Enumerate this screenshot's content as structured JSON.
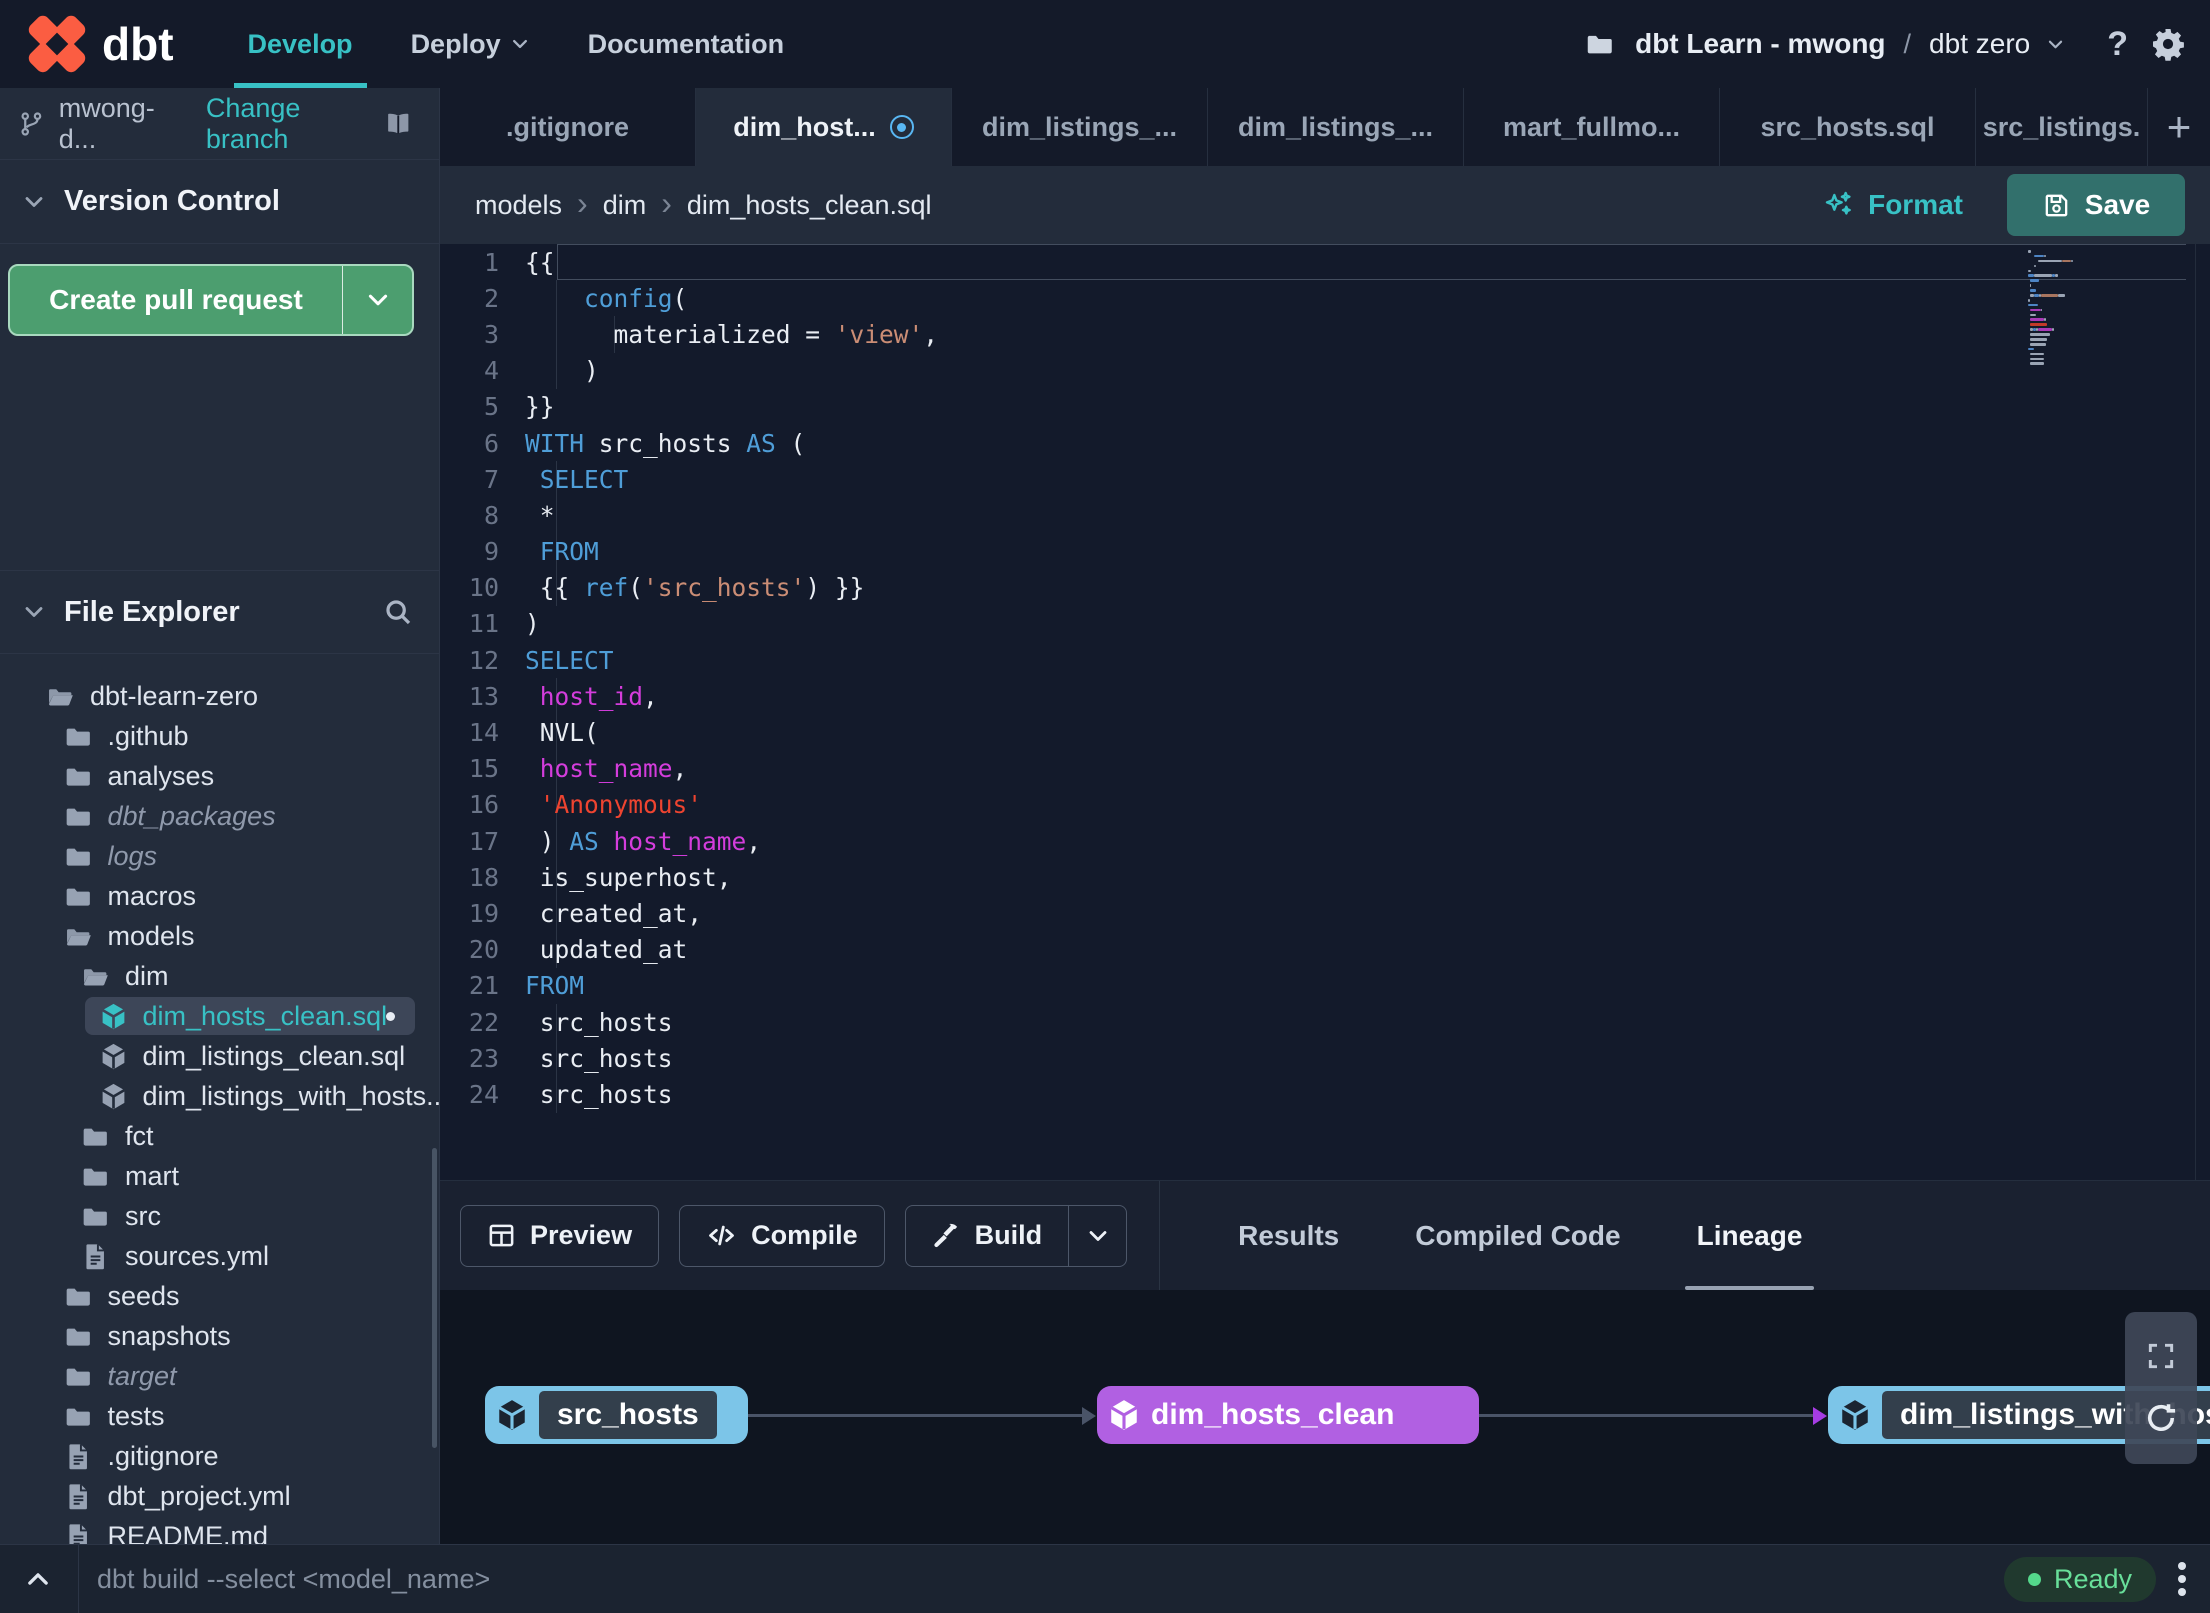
{
  "nav": {
    "brand": "dbt",
    "items": [
      {
        "label": "Develop",
        "active": true
      },
      {
        "label": "Deploy",
        "chevron": true
      },
      {
        "label": "Documentation"
      }
    ],
    "project": {
      "name": "dbt Learn - mwong",
      "separator": "/",
      "env": "dbt zero"
    }
  },
  "sidebar": {
    "branch": {
      "name": "mwong-d...",
      "change_label": "Change branch"
    },
    "version_control": {
      "title": "Version Control",
      "create_pr_label": "Create pull request"
    },
    "file_explorer": {
      "title": "File Explorer",
      "tree": [
        {
          "label": "dbt-learn-zero",
          "type": "folder-open",
          "level": 0
        },
        {
          "label": ".github",
          "type": "folder",
          "level": 1
        },
        {
          "label": "analyses",
          "type": "folder",
          "level": 1
        },
        {
          "label": "dbt_packages",
          "type": "folder",
          "level": 1,
          "italic": true
        },
        {
          "label": "logs",
          "type": "folder",
          "level": 1,
          "italic": true
        },
        {
          "label": "macros",
          "type": "folder",
          "level": 1
        },
        {
          "label": "models",
          "type": "folder-open",
          "level": 1
        },
        {
          "label": "dim",
          "type": "folder-open",
          "level": 2
        },
        {
          "label": "dim_hosts_clean.sql",
          "type": "model",
          "level": 3,
          "selected": true,
          "unsaved": true
        },
        {
          "label": "dim_listings_clean.sql",
          "type": "model",
          "level": 3
        },
        {
          "label": "dim_listings_with_hosts...",
          "type": "model",
          "level": 3
        },
        {
          "label": "fct",
          "type": "folder",
          "level": 2
        },
        {
          "label": "mart",
          "type": "folder",
          "level": 2
        },
        {
          "label": "src",
          "type": "folder",
          "level": 2
        },
        {
          "label": "sources.yml",
          "type": "file",
          "level": 2
        },
        {
          "label": "seeds",
          "type": "folder",
          "level": 1
        },
        {
          "label": "snapshots",
          "type": "folder",
          "level": 1
        },
        {
          "label": "target",
          "type": "folder",
          "level": 1,
          "italic": true
        },
        {
          "label": "tests",
          "type": "folder",
          "level": 1
        },
        {
          "label": ".gitignore",
          "type": "file",
          "level": 1
        },
        {
          "label": "dbt_project.yml",
          "type": "file",
          "level": 1
        },
        {
          "label": "README.md",
          "type": "file",
          "level": 1
        }
      ]
    }
  },
  "tabs": {
    "items": [
      {
        "label": ".gitignore"
      },
      {
        "label": "dim_host...",
        "active": true,
        "dirty": true
      },
      {
        "label": "dim_listings_..."
      },
      {
        "label": "dim_listings_..."
      },
      {
        "label": "mart_fullmo..."
      },
      {
        "label": "src_hosts.sql"
      },
      {
        "label": "src_listings."
      }
    ],
    "add_label": "+"
  },
  "editor": {
    "breadcrumb": [
      "models",
      "dim",
      "dim_hosts_clean.sql"
    ],
    "format_label": "Format",
    "save_label": "Save",
    "lines": [
      {
        "n": 1,
        "active": true,
        "t": [
          [
            "{{",
            "p"
          ]
        ]
      },
      {
        "n": 2,
        "g": [
          0
        ],
        "t": [
          [
            "    ",
            "p"
          ],
          [
            "config",
            "k"
          ],
          [
            "(",
            "p"
          ]
        ]
      },
      {
        "n": 3,
        "g": [
          0,
          4
        ],
        "t": [
          [
            "      materialized = ",
            "p"
          ],
          [
            "'view'",
            "s"
          ],
          [
            ",",
            "p"
          ]
        ]
      },
      {
        "n": 4,
        "g": [
          0
        ],
        "t": [
          [
            "    )",
            "p"
          ]
        ]
      },
      {
        "n": 5,
        "t": [
          [
            "}}",
            "p"
          ]
        ]
      },
      {
        "n": 6,
        "t": [
          [
            "WITH",
            "k"
          ],
          [
            " src_hosts ",
            "p"
          ],
          [
            "AS",
            "k"
          ],
          [
            " (",
            "p"
          ]
        ]
      },
      {
        "n": 7,
        "g": [
          0
        ],
        "t": [
          [
            " ",
            "p"
          ],
          [
            "SELECT",
            "k"
          ]
        ]
      },
      {
        "n": 8,
        "g": [
          0
        ],
        "t": [
          [
            " *",
            "p"
          ]
        ]
      },
      {
        "n": 9,
        "g": [
          0
        ],
        "t": [
          [
            " ",
            "p"
          ],
          [
            "FROM",
            "k"
          ]
        ]
      },
      {
        "n": 10,
        "g": [
          0
        ],
        "t": [
          [
            " {{ ",
            "p"
          ],
          [
            "ref",
            "k"
          ],
          [
            "(",
            "p"
          ],
          [
            "'src_hosts'",
            "s"
          ],
          [
            ") }}",
            "p"
          ]
        ]
      },
      {
        "n": 11,
        "t": [
          [
            ")",
            "p"
          ]
        ]
      },
      {
        "n": 12,
        "t": [
          [
            "SELECT",
            "k"
          ]
        ]
      },
      {
        "n": 13,
        "g": [
          0
        ],
        "t": [
          [
            " ",
            "p"
          ],
          [
            "host_id",
            "f"
          ],
          [
            ",",
            "p"
          ]
        ]
      },
      {
        "n": 14,
        "g": [
          0
        ],
        "t": [
          [
            " NVL(",
            "p"
          ]
        ]
      },
      {
        "n": 15,
        "g": [
          0
        ],
        "t": [
          [
            " ",
            "p"
          ],
          [
            "host_name",
            "f"
          ],
          [
            ",",
            "p"
          ]
        ]
      },
      {
        "n": 16,
        "g": [
          0
        ],
        "t": [
          [
            " ",
            "p"
          ],
          [
            "'Anonymous'",
            "r"
          ]
        ]
      },
      {
        "n": 17,
        "g": [
          0
        ],
        "t": [
          [
            " ) ",
            "p"
          ],
          [
            "AS",
            "k"
          ],
          [
            " ",
            "p"
          ],
          [
            "host_name",
            "f"
          ],
          [
            ",",
            "p"
          ]
        ]
      },
      {
        "n": 18,
        "g": [
          0
        ],
        "t": [
          [
            " is_superhost,",
            "p"
          ]
        ]
      },
      {
        "n": 19,
        "g": [
          0
        ],
        "t": [
          [
            " created_at,",
            "p"
          ]
        ]
      },
      {
        "n": 20,
        "g": [
          0
        ],
        "t": [
          [
            " updated_at",
            "p"
          ]
        ]
      },
      {
        "n": 21,
        "t": [
          [
            "FROM",
            "k"
          ]
        ]
      },
      {
        "n": 22,
        "g": [
          0
        ],
        "t": [
          [
            " src_hosts",
            "p"
          ]
        ]
      },
      {
        "n": 23,
        "g": [
          0
        ],
        "t": [
          [
            " src_hosts",
            "p"
          ]
        ]
      },
      {
        "n": 24,
        "g": [
          0
        ],
        "t": [
          [
            " src_hosts",
            "p"
          ]
        ]
      }
    ]
  },
  "bottom_panel": {
    "preview_label": "Preview",
    "compile_label": "Compile",
    "build_label": "Build",
    "tabs": [
      {
        "label": "Results"
      },
      {
        "label": "Compiled Code"
      },
      {
        "label": "Lineage",
        "active": true
      }
    ]
  },
  "lineage": {
    "nodes": [
      {
        "label": "src_hosts",
        "color": "blue"
      },
      {
        "label": "dim_hosts_clean",
        "color": "purple"
      },
      {
        "label": "dim_listings_with_hosts",
        "color": "blue"
      }
    ]
  },
  "command_bar": {
    "placeholder": "dbt build --select <model_name>",
    "status": "Ready"
  },
  "colors": {
    "accent_teal": "#38c1c5",
    "brand_orange": "#fb5d42",
    "pr_green": "#4c9e6f",
    "save_teal": "#32706c",
    "node_blue": "#7cc5e8",
    "node_purple": "#b160e2",
    "ready_green": "#68df9a",
    "unsaved_blue": "#59b7f3"
  }
}
